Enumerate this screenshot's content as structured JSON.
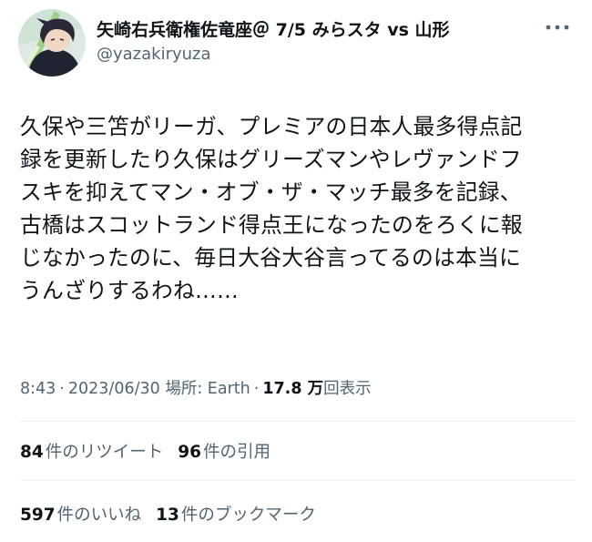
{
  "author": {
    "display_name": "矢崎右兵衛権佐竜座＠ 7/5 みらスタ vs 山形",
    "handle": "@yazakiryuza",
    "avatar_icon": "profile-avatar"
  },
  "header": {
    "more_icon": "more-options-icon"
  },
  "tweet": {
    "text": "久保や三笘がリーガ、プレミアの日本人最多得点記\n録を更新したり久保はグリーズマンやレヴァンドフ\nスキを抑えてマン・オブ・ザ・マッチ最多を記録、\n古橋はスコットランド得点王になったのをろくに報\nじなかったのに、毎日大谷大谷言ってるのは本当に\nうんざりするわね……"
  },
  "meta": {
    "time": "8:43",
    "date": "2023/06/30",
    "location": "場所: Earth",
    "views_count": "17.8 万",
    "views_label": "回表示"
  },
  "stats": {
    "retweets": {
      "count": "84",
      "label": "件のリツイート"
    },
    "quotes": {
      "count": "96",
      "label": "件の引用"
    },
    "likes": {
      "count": "597",
      "label": "件のいいね"
    },
    "bookmarks": {
      "count": "13",
      "label": "件のブックマーク"
    }
  },
  "colors": {
    "text": "#0f1419",
    "secondary": "#536471",
    "divider": "#eff3f4"
  }
}
